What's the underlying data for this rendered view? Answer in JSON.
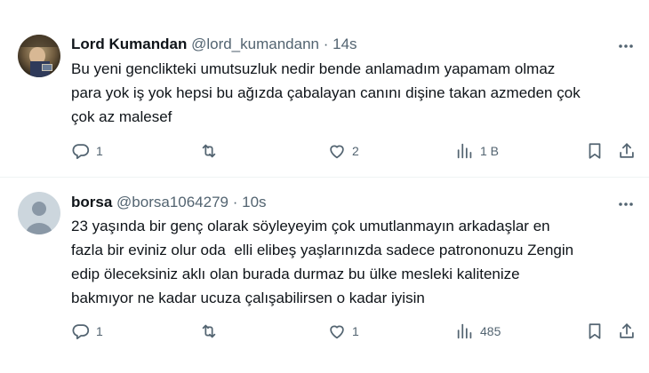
{
  "tweets": [
    {
      "name": "Lord Kumandan",
      "handle": "@lord_kumandann",
      "separator": "·",
      "time": "14s",
      "text": "Bu yeni genclikteki umutsuzluk nedir bende anlamadım yapamam olmaz\npara yok iş yok hepsi bu ağızda çabalayan canını dişine takan azmeden çok\nçok az malesef",
      "replies": "1",
      "retweets": "",
      "likes": "2",
      "views": "1 B",
      "avatar": "photo-avatar"
    },
    {
      "name": "borsa",
      "handle": "@borsa1064279",
      "separator": "·",
      "time": "10s",
      "text": "23 yaşında bir genç olarak söyleyeyim çok umutlanmayın arkadaşlar en\nfazla bir eviniz olur oda  elli elibeş yaşlarınızda sadece patrononuzu Zengin\nedip öleceksiniz aklı olan burada durmaz bu ülke mesleki kalitenize\nbakmıyor ne kadar ucuza çalışabilirsen o kadar iyisin",
      "replies": "1",
      "retweets": "",
      "likes": "1",
      "views": "485",
      "avatar": "default-avatar"
    }
  ],
  "colors": {
    "text": "#0f1419",
    "muted": "#536471",
    "divider": "#eff3f4",
    "default_avatar_bg": "#ccd6dd"
  },
  "icons": [
    "reply-icon",
    "retweet-icon",
    "like-icon",
    "views-icon",
    "bookmark-icon",
    "share-icon",
    "more-icon"
  ]
}
